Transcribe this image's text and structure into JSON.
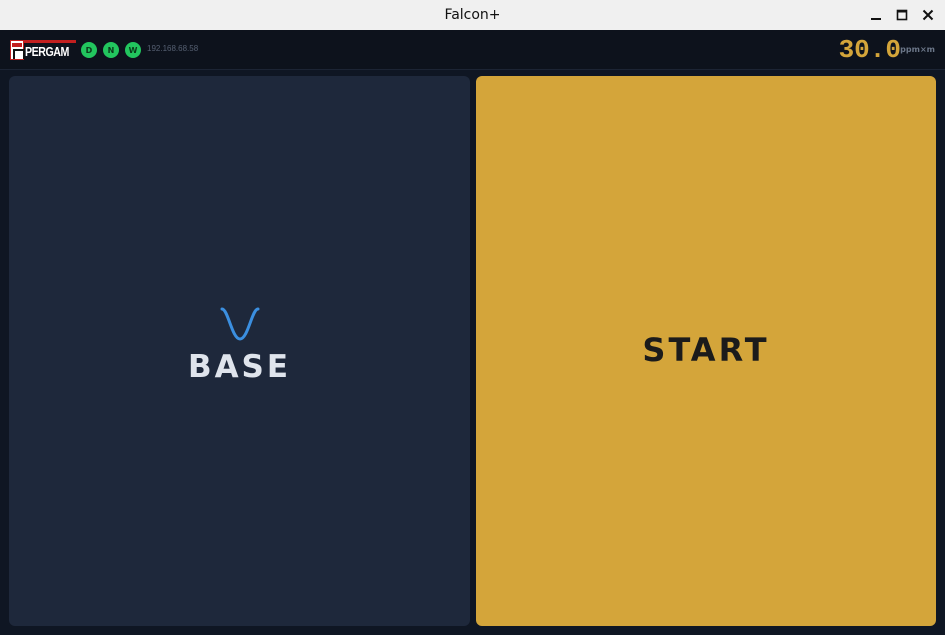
{
  "window": {
    "title": "Falcon+"
  },
  "header": {
    "logo_text": "PERGAM",
    "status_indicators": [
      {
        "label": "D",
        "color": "#22c55e"
      },
      {
        "label": "N",
        "color": "#22c55e"
      },
      {
        "label": "W",
        "color": "#22c55e"
      }
    ],
    "ip_address": "192.168.68.58",
    "reading_value": "30.0",
    "reading_unit": "ppm×m"
  },
  "panels": {
    "base": {
      "label": "BASE",
      "icon": "curve-icon"
    },
    "start": {
      "label": "START"
    }
  },
  "colors": {
    "accent": "#d4a53a",
    "panel_dark": "#1e283b",
    "background": "#0f1623",
    "status_ok": "#22c55e",
    "icon_blue": "#3b8fe0"
  }
}
